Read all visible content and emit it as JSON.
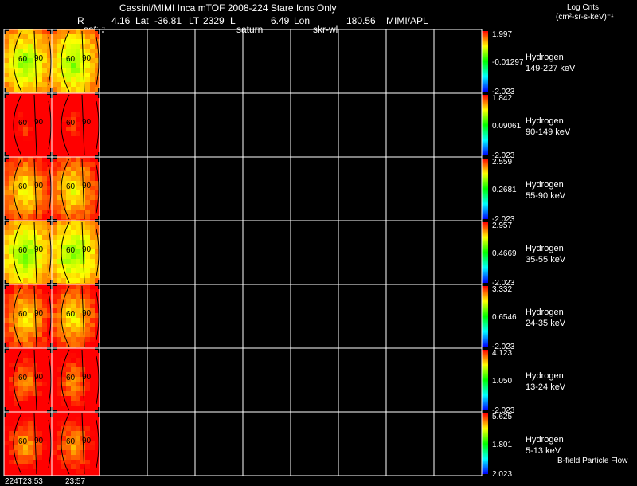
{
  "header": {
    "title_line": "Cassini/MIMI Inca mTOF  2008-224   Stare   Ions Only",
    "r_label": "R",
    "r_value": "4.16",
    "lat_label": "Lat",
    "lat_value": "-36.81",
    "lt_label": "LT",
    "lt_value": "2329",
    "l_label": "L",
    "l_value": "6.49",
    "lon_label": "Lon",
    "lon_value": "180.56",
    "source": "MIMI/APL",
    "sublabel_1": "satur",
    "sublabel_2": "saturn",
    "sublabel_3": "skr-wl"
  },
  "units": {
    "line1": "Log Cnts",
    "line2": "(cm²-sr-s-keV)⁻¹"
  },
  "footer": {
    "time_1": "224T23:53",
    "time_2": "23:57",
    "bfield_label": "B-field Particle Flow"
  },
  "colors": {
    "background": "#000000",
    "grid": "#ffffff",
    "colorbar_top": "#ff0000",
    "colorbar_bottom": "#0000ff"
  },
  "chart_data": {
    "type": "heatmap",
    "title": "Cassini/MIMI Inca mTOF  2008-224   Stare   Ions Only",
    "grid_columns": 10,
    "filled_columns": 2,
    "time_labels": [
      "224T23:53",
      "23:57"
    ],
    "contour_labels": [
      "60",
      "90"
    ],
    "colorscale": [
      "#0000ff",
      "#00ffff",
      "#00ff00",
      "#ffff00",
      "#ff0000"
    ],
    "rows": [
      {
        "species": "Hydrogen",
        "energy": "149-227 keV",
        "max": "1.997",
        "mid": "-0.01297",
        "min": "-2.023",
        "level": 0.62
      },
      {
        "species": "Hydrogen",
        "energy": "90-149 keV",
        "max": "1.842",
        "mid": "0.09061",
        "min": "-2.023",
        "level": 0.92
      },
      {
        "species": "Hydrogen",
        "energy": "55-90 keV",
        "max": "2.559",
        "mid": "0.2681",
        "min": "-2.023",
        "level": 0.72
      },
      {
        "species": "Hydrogen",
        "energy": "35-55 keV",
        "max": "2.957",
        "mid": "0.4669",
        "min": "-2.023",
        "level": 0.6
      },
      {
        "species": "Hydrogen",
        "energy": "24-35 keV",
        "max": "3.332",
        "mid": "0.6546",
        "min": "-2.023",
        "level": 0.74
      },
      {
        "species": "Hydrogen",
        "energy": "13-24 keV",
        "max": "4.123",
        "mid": "1.050",
        "min": "-2.023",
        "level": 0.84
      },
      {
        "species": "Hydrogen",
        "energy": "5-13 keV",
        "max": "5.625",
        "mid": "1.801",
        "min": "2.023",
        "level": 0.82
      }
    ]
  }
}
